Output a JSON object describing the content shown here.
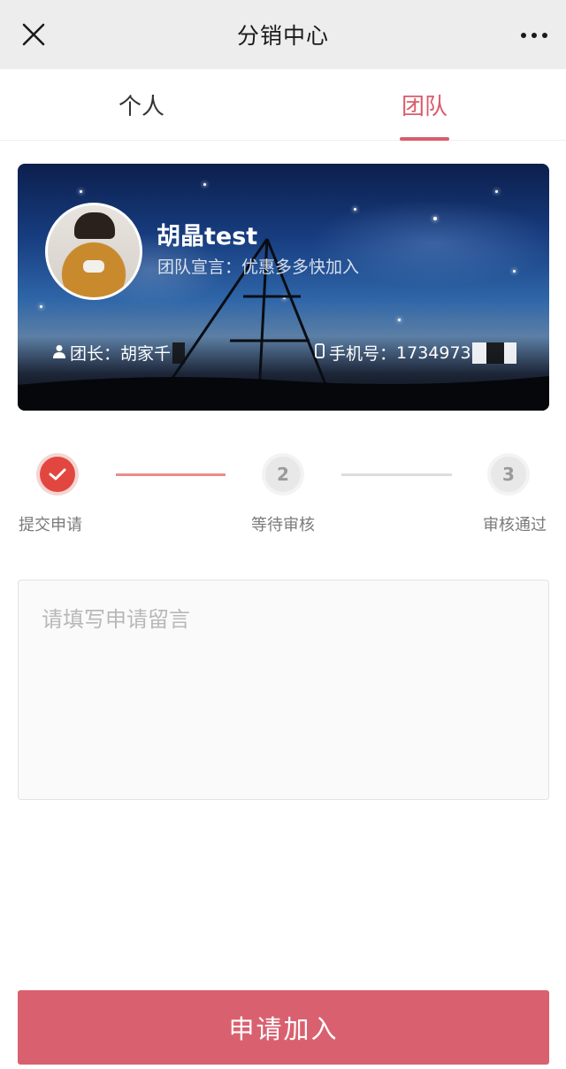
{
  "navbar": {
    "title": "分销中心",
    "close_icon": "close-icon",
    "more_icon": "more-horizontal-icon"
  },
  "tabs": [
    {
      "label": "个人",
      "active": false
    },
    {
      "label": "团队",
      "active": true
    }
  ],
  "team": {
    "name": "胡晶test",
    "slogan": "团队宣言：优惠多多快加入",
    "leader_label": "团长：",
    "leader_name": "胡家千",
    "phone_label": "手机号：",
    "phone": "1734973",
    "leader_icon": "person-icon",
    "phone_icon": "phone-icon"
  },
  "steps": [
    {
      "label": "提交申请",
      "number": "",
      "status": "done"
    },
    {
      "label": "等待审核",
      "number": "2",
      "status": "todo"
    },
    {
      "label": "审核通过",
      "number": "3",
      "status": "todo"
    }
  ],
  "message": {
    "placeholder": "请填写申请留言",
    "value": ""
  },
  "join_button": {
    "label": "申请加入"
  },
  "colors": {
    "accent": "#d95c6c",
    "step_done": "#e2473f",
    "button": "#d9616f",
    "navbar_bg": "#ededed"
  }
}
